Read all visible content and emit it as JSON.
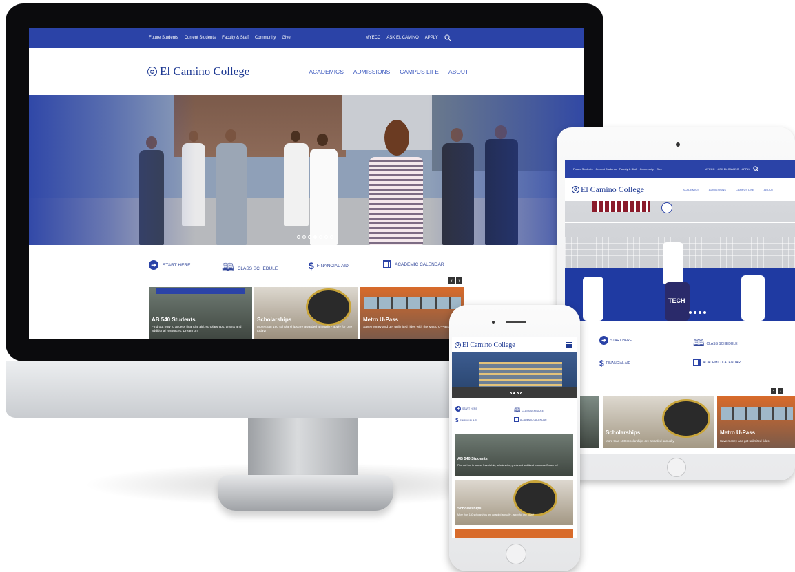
{
  "desktop": {
    "topnav": {
      "links": [
        "Future Students",
        "Current Students",
        "Faculty & Staff",
        "Community",
        "Give"
      ],
      "right": [
        "MYECC",
        "ASK EL CAMINO",
        "APPLY"
      ]
    },
    "logo": "El Camino College",
    "mainnav": [
      "ACADEMICS",
      "ADMISSIONS",
      "CAMPUS LIFE",
      "ABOUT"
    ],
    "quicklinks": [
      "START HERE",
      "CLASS SCHEDULE",
      "FINANCIAL AID",
      "ACADEMIC CALENDAR"
    ],
    "cards": [
      {
        "title": "AB 540 Students",
        "desc": "Find out how to access financial aid, scholarships, grants and additional resources. Dream on!"
      },
      {
        "title": "Scholarships",
        "desc": "More than 180 scholarships are awarded annually - apply for one today!"
      },
      {
        "title": "Metro U-Pass",
        "desc": "Save money and get unlimited rides with the Metro U-Pass!"
      }
    ]
  },
  "tablet": {
    "topnav": {
      "links": [
        "Future Students",
        "Current Students",
        "Faculty & Staff",
        "Community",
        "Give"
      ],
      "right": [
        "MYECC",
        "ASK EL CAMINO",
        "APPLY"
      ]
    },
    "logo": "El Camino College",
    "mainnav": [
      "ACADEMICS",
      "ADMISSIONS",
      "CAMPUS LIFE",
      "ABOUT"
    ],
    "quicklinks": [
      "START HERE",
      "CLASS SCHEDULE",
      "FINANCIAL AID",
      "ACADEMIC CALENDAR"
    ],
    "jersey_text": "TECH",
    "cards": [
      {
        "title": "Scholarships",
        "desc": "More than 180 scholarships are awarded annually"
      },
      {
        "title": "Metro U-Pass",
        "desc": "Save money and get unlimited rides"
      }
    ]
  },
  "phone": {
    "logo": "El Camino College",
    "quicklinks": [
      "START HERE",
      "CLASS SCHEDULE",
      "FINANCIAL AID",
      "ACADEMIC CALENDAR"
    ],
    "cards": [
      {
        "title": "AB 540 Students",
        "desc": "Find out how to access financial aid, scholarships, grants and additional resources. Dream on!"
      },
      {
        "title": "Scholarships",
        "desc": "More than 180 scholarships are awarded annually - apply for one today!"
      }
    ]
  },
  "colors": {
    "brand_blue": "#2b43a7",
    "logo_blue": "#1f3a93"
  }
}
